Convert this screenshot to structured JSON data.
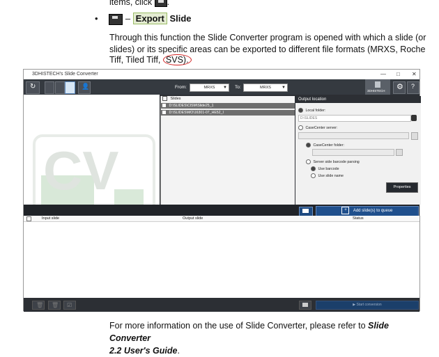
{
  "doc": {
    "top_text": "items, click",
    "bullet_title_prefix": "–",
    "bullet_title_highlight": "Export",
    "bullet_title_rest": "Slide",
    "paragraph_1a": "Through this function the Slide Converter program is opened with which a slide (or",
    "paragraph_1b": "slides) or its specific areas can be exported to different file formats (MRXS, Roche",
    "paragraph_1c": "Tiff, Tiled Tiff,",
    "paragraph_1d": "SVS).",
    "footer_text": "For more information on the use of Slide Converter, please refer to",
    "footer_guide_1": "Slide Converter",
    "footer_guide_2": "2.2 User's Guide",
    "footer_period": "."
  },
  "window": {
    "title": "3DHISTECH's Slide Converter",
    "from_label": "From:",
    "from_value": "MRXS",
    "to_label": "To:",
    "to_value": "MRXS",
    "brand": "3DHISTECH",
    "slides_header": "Slides",
    "slides": [
      "D:\\SLIDES\\CISM\\Slide25_1",
      "D:\\SLIDES\\MO\\16301-07_HE52_I"
    ],
    "output": {
      "title": "Output location",
      "local_folder": "Local folder:",
      "local_path": "D:\\SLIDES",
      "casecenter_server": "CaseCenter server:",
      "casecenter_folder": "CaseCenter folder:",
      "server_side": "Server side barcode parsing",
      "use_barcode": "Use barcode",
      "use_slide_name": "Use slide name",
      "properties": "Properties",
      "add_queue": "Add slide(s) to queue"
    },
    "table": {
      "headers": [
        "Input slide",
        "Output slide",
        "Status"
      ]
    },
    "start_conversion": "Start conversion"
  }
}
